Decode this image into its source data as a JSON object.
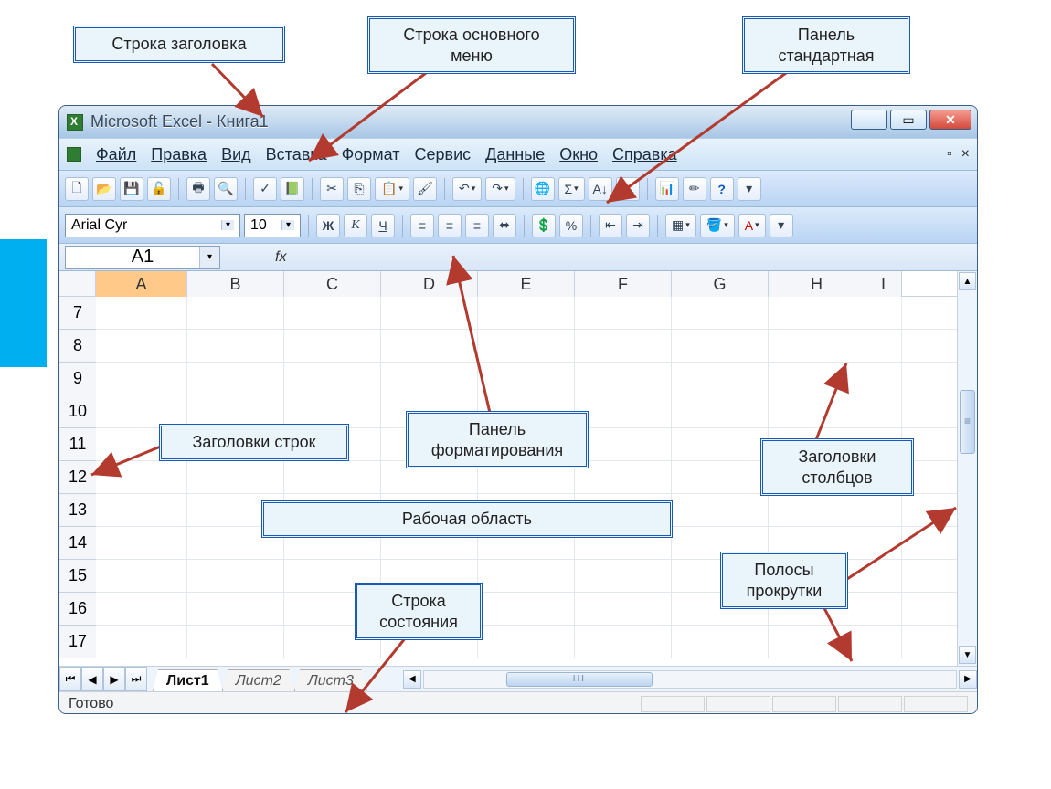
{
  "callouts": {
    "title_row": "Строка заголовка",
    "menu_row": "Строка основного\nменю",
    "std_panel": "Панель\nстандартная",
    "row_headers": "Заголовки строк",
    "fmt_panel": "Панель\nформатирования",
    "col_headers": "Заголовки\nстолбцов",
    "work_area": "Рабочая область",
    "statusbar": "Строка\nсостояния",
    "scrollbars": "Полосы\nпрокрутки"
  },
  "window": {
    "title": "Microsoft Excel - Книга1",
    "menu": [
      "Файл",
      "Правка",
      "Вид",
      "Вставка",
      "Формат",
      "Сервис",
      "Данные",
      "Окно",
      "Справка"
    ],
    "toolbar_std_icons": [
      "new",
      "open",
      "save",
      "permission",
      "print",
      "preview",
      "spelling",
      "research",
      "cut",
      "copy",
      "paste",
      "format-painter",
      "undo",
      "redo",
      "hyperlink",
      "autosum",
      "sort-asc",
      "sort-desc",
      "chart",
      "drawing",
      "help"
    ],
    "formatbar": {
      "font": "Arial Cyr",
      "size": "10",
      "buttons": [
        "Ж",
        "К",
        "Ч",
        "align-left",
        "align-center",
        "align-right",
        "merge",
        "currency",
        "percent",
        "indent-dec",
        "indent-inc",
        "borders",
        "fill",
        "font-color"
      ]
    },
    "namebox": "A1",
    "fx_label": "fx",
    "columns": [
      "A",
      "B",
      "C",
      "D",
      "E",
      "F",
      "G",
      "H",
      "I"
    ],
    "rows": [
      "7",
      "8",
      "9",
      "10",
      "11",
      "12",
      "13",
      "14",
      "15",
      "16",
      "17"
    ],
    "sheet_tabs": [
      "Лист1",
      "Лист2",
      "Лист3"
    ],
    "active_tab": 0,
    "status": "Готово",
    "hscroll_thumb": "III"
  }
}
